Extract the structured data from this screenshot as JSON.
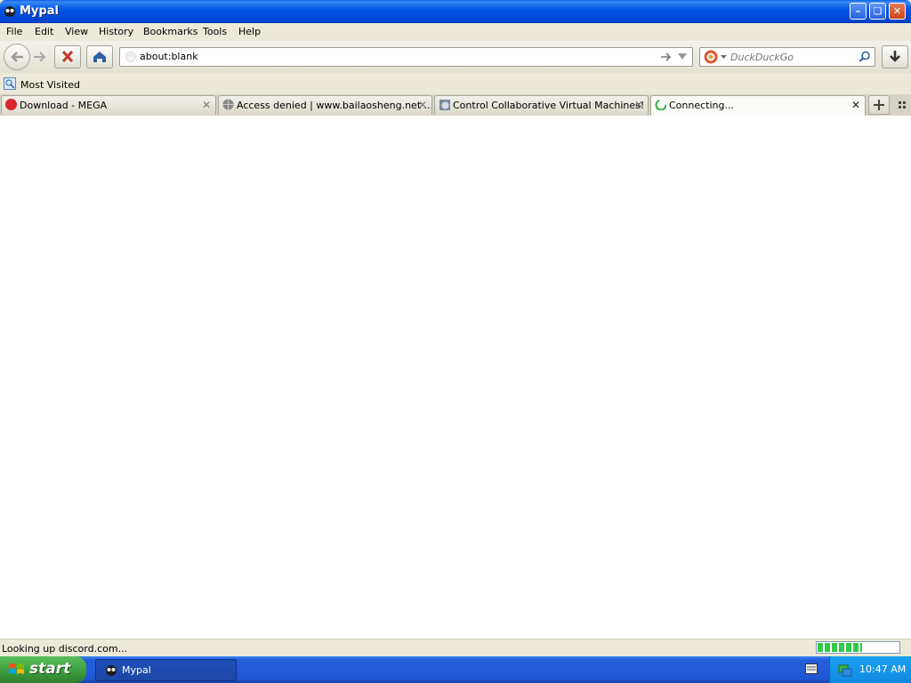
{
  "window": {
    "title": "Mypal"
  },
  "menu": [
    "File",
    "Edit",
    "View",
    "History",
    "Bookmarks",
    "Tools",
    "Help"
  ],
  "navbar": {
    "url": "about:blank",
    "search_placeholder": "DuckDuckGo"
  },
  "bookmarks": {
    "most_visited": "Most Visited"
  },
  "tabs": [
    {
      "label": "Download - MEGA"
    },
    {
      "label": "Access denied | www.bailaosheng.net ..."
    },
    {
      "label": "Control Collaborative Virtual Machines!"
    },
    {
      "label": "Connecting..."
    }
  ],
  "status": {
    "text": "Looking up discord.com...",
    "progress": 0.55
  },
  "taskbar": {
    "start_label": "start",
    "task_label": "Mypal",
    "clock": "10:47 AM"
  },
  "colors": {
    "titlebar": "#0055e5",
    "taskbar": "#245edb",
    "start": "#3a9b3a",
    "mega_red": "#d9272e"
  },
  "icons": [
    "mypal-icon",
    "back-icon",
    "forward-icon",
    "stop-icon",
    "home-icon",
    "search-icon",
    "download-icon",
    "mega-icon",
    "globe-icon",
    "vm-icon",
    "loading-icon",
    "new-tab-icon",
    "windows-logo-icon",
    "keyboard-icon",
    "network-icon"
  ]
}
